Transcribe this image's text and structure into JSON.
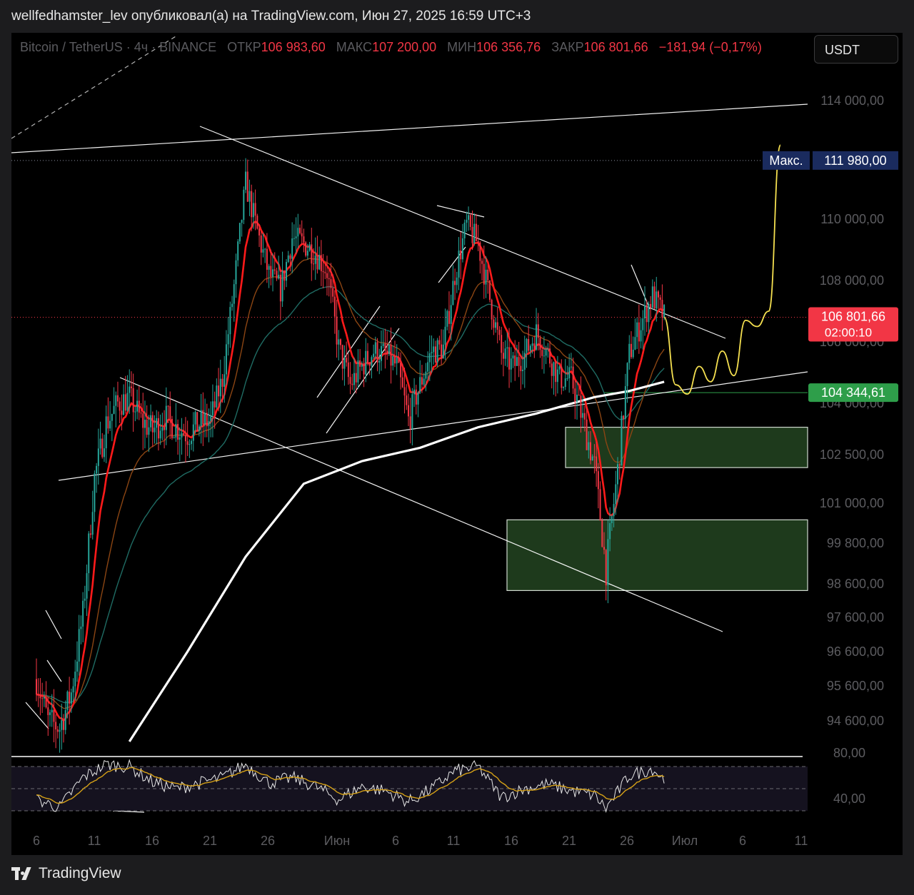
{
  "header": {
    "author_line": "wellfedhamster_lev опубликовал(а) на TradingView.com, Июн 27, 2025 16:59 UTC+3"
  },
  "symbol_bar": {
    "symbol": "Bitcoin / TetherUS · 4ч · BINANCE",
    "open_label": "ОТКР",
    "open_value": "106 983,60",
    "high_label": "МАКС",
    "high_value": "107 200,00",
    "low_label": "МИН",
    "low_value": "106 356,76",
    "close_label": "ЗАКР",
    "close_value": "106 801,66",
    "change": "−181,94 (−0,17%)"
  },
  "currency_button": "USDT",
  "price_axis": {
    "ticks": [
      "114 000,00",
      "110 000,00",
      "108 000,00",
      "106 000,00",
      "104 000,00",
      "102 500,00",
      "101 000,00",
      "99 800,00",
      "98 600,00",
      "97 600,00",
      "96 600,00",
      "95 600,00",
      "94 600,00"
    ],
    "max_label": "Макс.",
    "max_value": "111 980,00",
    "last_price": "106 801,66",
    "countdown": "02:00:10",
    "level_price": "104 344,61"
  },
  "rsi_axis": {
    "ticks": [
      "80,00",
      "40,00"
    ]
  },
  "time_axis": {
    "ticks": [
      "6",
      "11",
      "16",
      "21",
      "26",
      "Июн",
      "6",
      "11",
      "16",
      "21",
      "26",
      "Июл",
      "6",
      "11"
    ]
  },
  "colors": {
    "up": "#26a69a",
    "down": "#f23645",
    "ema_fast": "#ff1a1a",
    "ma_slow": "#ffffff",
    "ma_teal": "#1f6b63",
    "ma_brown": "#8b4513",
    "zone_fill": "#1e3a1c",
    "forecast": "#f5e050",
    "rsi": "#e6e6e6",
    "rsi_signal": "#d4a017",
    "max_label_bg": "#1a2b5e",
    "last_price_bg": "#f23645",
    "level_bg": "#2e9e4a"
  },
  "chart_data": {
    "type": "candlestick",
    "instrument": "Bitcoin / TetherUS",
    "timeframe": "4ч",
    "x_range": [
      "2025-05-04",
      "2025-07-12"
    ],
    "y_range": [
      94000,
      115000
    ],
    "visible_high": 111980.0,
    "last_close": 106801.66,
    "horizontal_level": 104344.61,
    "close_path": [
      {
        "date": "2025-05-04",
        "close": 95800
      },
      {
        "date": "2025-05-05",
        "close": 94600
      },
      {
        "date": "2025-05-06",
        "close": 94400
      },
      {
        "date": "2025-05-07",
        "close": 95400
      },
      {
        "date": "2025-05-08",
        "close": 97700
      },
      {
        "date": "2025-05-09",
        "close": 101800
      },
      {
        "date": "2025-05-10",
        "close": 103400
      },
      {
        "date": "2025-05-11",
        "close": 104000
      },
      {
        "date": "2025-05-12",
        "close": 104200
      },
      {
        "date": "2025-05-13",
        "close": 103500
      },
      {
        "date": "2025-05-14",
        "close": 103200
      },
      {
        "date": "2025-05-15",
        "close": 103600
      },
      {
        "date": "2025-05-16",
        "close": 103300
      },
      {
        "date": "2025-05-17",
        "close": 103100
      },
      {
        "date": "2025-05-18",
        "close": 103400
      },
      {
        "date": "2025-05-19",
        "close": 103500
      },
      {
        "date": "2025-05-20",
        "close": 104800
      },
      {
        "date": "2025-05-21",
        "close": 107800
      },
      {
        "date": "2025-05-22",
        "close": 111200
      },
      {
        "date": "2025-05-23",
        "close": 109600
      },
      {
        "date": "2025-05-24",
        "close": 108200
      },
      {
        "date": "2025-05-25",
        "close": 107700
      },
      {
        "date": "2025-05-26",
        "close": 109400
      },
      {
        "date": "2025-05-27",
        "close": 109200
      },
      {
        "date": "2025-05-28",
        "close": 108900
      },
      {
        "date": "2025-05-29",
        "close": 108300
      },
      {
        "date": "2025-05-30",
        "close": 105800
      },
      {
        "date": "2025-05-31",
        "close": 104600
      },
      {
        "date": "2025-06-01",
        "close": 105200
      },
      {
        "date": "2025-06-02",
        "close": 105700
      },
      {
        "date": "2025-06-03",
        "close": 105600
      },
      {
        "date": "2025-06-04",
        "close": 105200
      },
      {
        "date": "2025-06-05",
        "close": 103500
      },
      {
        "date": "2025-06-06",
        "close": 104600
      },
      {
        "date": "2025-06-07",
        "close": 105700
      },
      {
        "date": "2025-06-08",
        "close": 105800
      },
      {
        "date": "2025-06-09",
        "close": 108200
      },
      {
        "date": "2025-06-10",
        "close": 109800
      },
      {
        "date": "2025-06-11",
        "close": 109200
      },
      {
        "date": "2025-06-12",
        "close": 107400
      },
      {
        "date": "2025-06-13",
        "close": 105600
      },
      {
        "date": "2025-06-14",
        "close": 105200
      },
      {
        "date": "2025-06-15",
        "close": 105600
      },
      {
        "date": "2025-06-16",
        "close": 106300
      },
      {
        "date": "2025-06-17",
        "close": 105600
      },
      {
        "date": "2025-06-18",
        "close": 104800
      },
      {
        "date": "2025-06-19",
        "close": 104800
      },
      {
        "date": "2025-06-20",
        "close": 103500
      },
      {
        "date": "2025-06-21",
        "close": 102200
      },
      {
        "date": "2025-06-22",
        "close": 99000
      },
      {
        "date": "2025-06-23",
        "close": 102000
      },
      {
        "date": "2025-06-24",
        "close": 105600
      },
      {
        "date": "2025-06-25",
        "close": 106600
      },
      {
        "date": "2025-06-26",
        "close": 107500
      },
      {
        "date": "2025-06-27",
        "close": 106800
      }
    ],
    "demand_zones": [
      {
        "low": 102100,
        "high": 103300
      },
      {
        "low": 98400,
        "high": 100500
      }
    ],
    "forecast_path": [
      {
        "date": "2025-06-27",
        "price": 106800
      },
      {
        "date": "2025-06-28",
        "price": 104600
      },
      {
        "date": "2025-06-29",
        "price": 104300
      },
      {
        "date": "2025-06-30",
        "price": 105200
      },
      {
        "date": "2025-07-01",
        "price": 104700
      },
      {
        "date": "2025-07-02",
        "price": 105700
      },
      {
        "date": "2025-07-03",
        "price": 104900
      },
      {
        "date": "2025-07-04",
        "price": 106700
      },
      {
        "date": "2025-07-05",
        "price": 106500
      },
      {
        "date": "2025-07-06",
        "price": 107000
      },
      {
        "date": "2025-07-07",
        "price": 112500
      }
    ],
    "ma_slow_path": [
      {
        "date": "2025-05-12",
        "value": 94000
      },
      {
        "date": "2025-05-17",
        "value": 96600
      },
      {
        "date": "2025-05-22",
        "value": 99400
      },
      {
        "date": "2025-05-27",
        "value": 101600
      },
      {
        "date": "2025-06-01",
        "value": 102300
      },
      {
        "date": "2025-06-06",
        "value": 102700
      },
      {
        "date": "2025-06-11",
        "value": 103300
      },
      {
        "date": "2025-06-16",
        "value": 103700
      },
      {
        "date": "2025-06-21",
        "value": 104200
      },
      {
        "date": "2025-06-24",
        "value": 104400
      },
      {
        "date": "2025-06-27",
        "value": 104700
      }
    ],
    "rsi": {
      "ylim": [
        20,
        90
      ],
      "bands": [
        70,
        50,
        30
      ],
      "values": [
        {
          "date": "2025-05-04",
          "v": 40
        },
        {
          "date": "2025-05-06",
          "v": 33
        },
        {
          "date": "2025-05-08",
          "v": 60
        },
        {
          "date": "2025-05-10",
          "v": 72
        },
        {
          "date": "2025-05-12",
          "v": 70
        },
        {
          "date": "2025-05-14",
          "v": 56
        },
        {
          "date": "2025-05-16",
          "v": 50
        },
        {
          "date": "2025-05-18",
          "v": 55
        },
        {
          "date": "2025-05-20",
          "v": 60
        },
        {
          "date": "2025-05-22",
          "v": 72
        },
        {
          "date": "2025-05-24",
          "v": 55
        },
        {
          "date": "2025-05-26",
          "v": 60
        },
        {
          "date": "2025-05-28",
          "v": 52
        },
        {
          "date": "2025-05-30",
          "v": 40
        },
        {
          "date": "2025-06-01",
          "v": 52
        },
        {
          "date": "2025-06-03",
          "v": 48
        },
        {
          "date": "2025-06-05",
          "v": 38
        },
        {
          "date": "2025-06-07",
          "v": 50
        },
        {
          "date": "2025-06-09",
          "v": 66
        },
        {
          "date": "2025-06-11",
          "v": 70
        },
        {
          "date": "2025-06-13",
          "v": 42
        },
        {
          "date": "2025-06-15",
          "v": 50
        },
        {
          "date": "2025-06-17",
          "v": 54
        },
        {
          "date": "2025-06-19",
          "v": 48
        },
        {
          "date": "2025-06-21",
          "v": 44
        },
        {
          "date": "2025-06-22",
          "v": 32
        },
        {
          "date": "2025-06-24",
          "v": 62
        },
        {
          "date": "2025-06-26",
          "v": 68
        },
        {
          "date": "2025-06-27",
          "v": 58
        }
      ]
    }
  }
}
